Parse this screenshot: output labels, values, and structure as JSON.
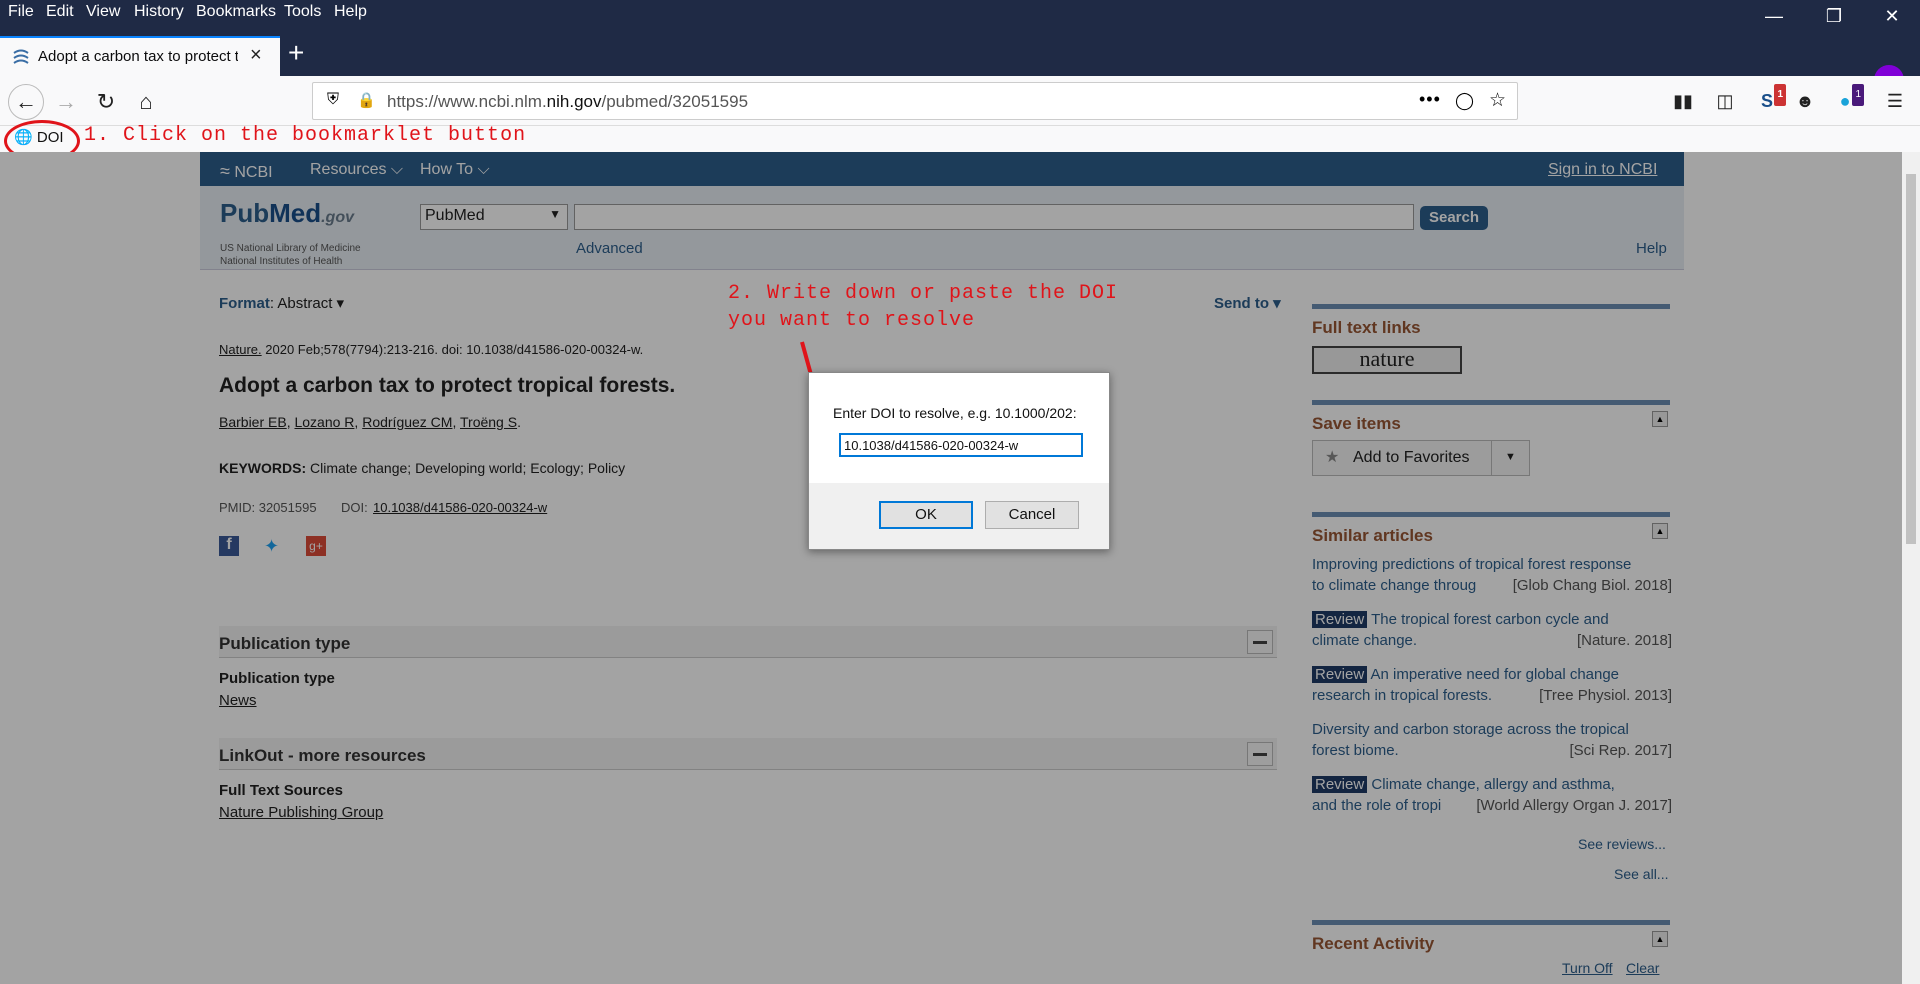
{
  "menu": {
    "items": [
      "File",
      "Edit",
      "View",
      "History",
      "Bookmarks",
      "Tools",
      "Help"
    ]
  },
  "tab": {
    "title": "Adopt a carbon tax to protect t",
    "close": "×"
  },
  "navbar": {
    "url_prefix": "https://www.ncbi.nlm.",
    "url_host": "nih.gov",
    "url_path": "/pubmed/32051595",
    "badge_a": "1",
    "badge_b": "1"
  },
  "bookmarks": {
    "doi_label": "DOI"
  },
  "annotations": {
    "step1": "1. Click on the bookmarklet button",
    "step2_line1": "2. Write down or paste the DOI",
    "step2_line2": "you want to resolve"
  },
  "ncbi": {
    "logo": "NCBI",
    "resources": "Resources",
    "howto": "How To",
    "signin": "Sign in to NCBI"
  },
  "pubmed": {
    "logo_pub": "Pub",
    "logo_med": "Med",
    "logo_gov": ".gov",
    "sub_line1": "US National Library of Medicine",
    "sub_line2": "National Institutes of Health",
    "db_value": "PubMed",
    "search_label": "Search",
    "advanced": "Advanced",
    "help": "Help"
  },
  "article": {
    "format_label": "Format",
    "format_value": "Abstract",
    "send_to": "Send to",
    "journal": "Nature.",
    "citation": "2020 Feb;578(7794):213-216. doi: 10.1038/d41586-020-00324-w.",
    "title": "Adopt a carbon tax to protect tropical forests.",
    "authors": [
      "Barbier EB",
      "Lozano R",
      "Rodríguez CM",
      "Troëng S"
    ],
    "keywords_label": "KEYWORDS:",
    "keywords": "Climate change; Developing world; Ecology; Policy",
    "pmid": "PMID: 32051595",
    "doi_label": "DOI:",
    "doi_value": "10.1038/d41586-020-00324-w"
  },
  "sections": [
    {
      "header": "Publication type",
      "sub": "Publication type",
      "link": "News"
    },
    {
      "header": "LinkOut - more resources",
      "sub": "Full Text Sources",
      "link": "Nature Publishing Group"
    }
  ],
  "right": {
    "full_text_links": "Full text links",
    "nature_logo": "nature",
    "save_items": "Save items",
    "add_fav": "Add to Favorites",
    "similar": "Similar articles",
    "review": "Review",
    "articles": [
      {
        "l1": "Improving predictions of tropical forest response",
        "l2": "to climate change throug",
        "src": "[Glob Chang Biol. 2018]",
        "review": false
      },
      {
        "l1": "The tropical forest carbon cycle and",
        "l2": "climate change.",
        "src": "[Nature. 2018]",
        "review": true
      },
      {
        "l1": "An imperative need for global change",
        "l2": "research in tropical forests.",
        "src": "[Tree Physiol. 2013]",
        "review": true
      },
      {
        "l1": "Diversity and carbon storage across the tropical",
        "l2": "forest biome.",
        "src": "[Sci Rep. 2017]",
        "review": false
      },
      {
        "l1": "Climate change, allergy and asthma,",
        "l2": "and the role of tropi",
        "src": "[World Allergy Organ J. 2017]",
        "review": true
      }
    ],
    "see_reviews": "See reviews...",
    "see_all": "See all...",
    "recent": "Recent Activity",
    "turn_off": "Turn Off",
    "clear": "Clear"
  },
  "dialog": {
    "label": "Enter DOI to resolve, e.g. 10.1000/202:",
    "value": "10.1038/d41586-020-00324-w",
    "ok": "OK",
    "cancel": "Cancel"
  }
}
